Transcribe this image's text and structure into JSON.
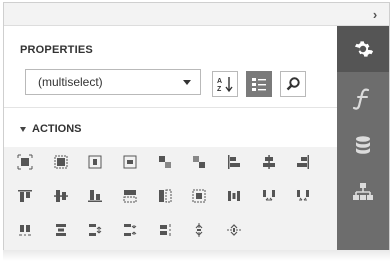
{
  "header": {
    "collapse_glyph": "›",
    "collapse_icon": "chevron-right-icon"
  },
  "properties": {
    "title": "PROPERTIES",
    "selector_value": "(multiselect)",
    "sort_button_icon": "sort-alphabetical-icon",
    "categories_button_icon": "categorized-list-icon",
    "search_button_icon": "search-icon"
  },
  "actions": {
    "title": "ACTIONS",
    "rows": [
      [
        "fit-bounds-icon",
        "fit-to-container-icon",
        "center-horizontally-icon",
        "center-vertically-icon",
        "bring-forward-icon",
        "send-backward-icon",
        "align-left-icon",
        "align-centers-icon",
        "align-right-icon"
      ],
      [
        "align-top-icon",
        "align-middles-icon",
        "align-bottom-icon",
        "make-same-width-icon",
        "make-same-height-icon",
        "make-same-size-icon",
        "horizontal-spacing-equal-icon",
        "horizontal-spacing-increase-icon",
        "horizontal-spacing-decrease-icon"
      ],
      [
        "horizontal-spacing-remove-icon",
        "vertical-spacing-equal-icon",
        "vertical-spacing-increase-icon",
        "vertical-spacing-decrease-icon",
        "vertical-spacing-remove-icon",
        "center-horizontally-in-band-icon",
        "center-vertically-in-band-icon"
      ]
    ]
  },
  "side_tabs": [
    "gear-icon",
    "function-icon",
    "database-icon",
    "report-tree-icon"
  ],
  "colors": {
    "side_bg": "#6d6d6d",
    "side_active": "#555555",
    "grid_bg": "#f2f2f2",
    "icon": "#555555"
  }
}
